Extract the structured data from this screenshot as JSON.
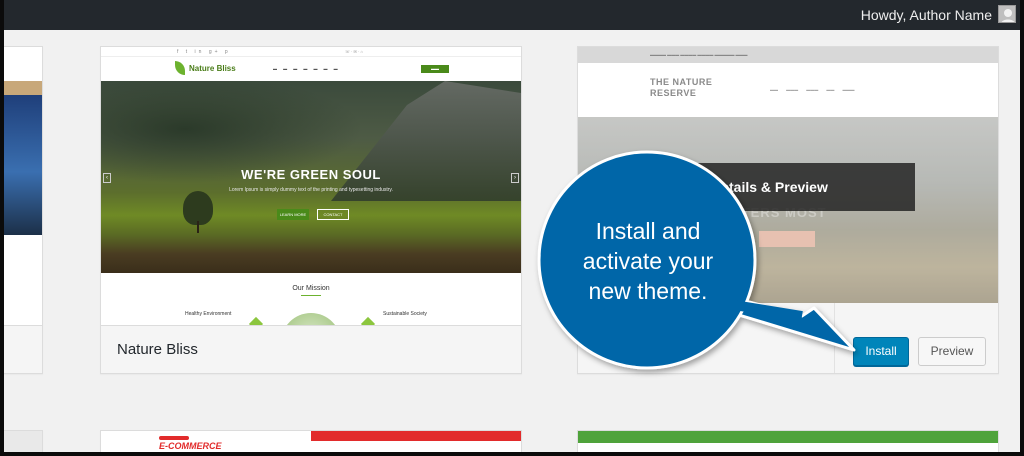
{
  "admin_bar": {
    "greeting": "Howdy, Author Name"
  },
  "themes": [
    {
      "name": "Nature Bliss",
      "screenshot": {
        "brand": "Nature Bliss",
        "headline": "WE'RE GREEN SOUL",
        "tagline": "Lorem Ipsum is simply dummy text of the printing and typesetting industry.",
        "primary_cta": "LEARN MORE",
        "secondary_cta": "CONTACT",
        "section_title": "Our Mission",
        "feature_1": "Healthy Environment",
        "feature_2": "Sustainable Society"
      }
    },
    {
      "name": "The Nature Reserve",
      "screenshot": {
        "logo_line1": "THE NATURE",
        "logo_line2": "RESERVE",
        "ghost_text": "T MATTERS MOST"
      },
      "overlay_label": "Details & Preview",
      "install_label": "Install",
      "preview_label": "Preview"
    },
    {
      "name": "E-Commerce",
      "screenshot": {
        "logo": "E-COMMERCE"
      }
    }
  ],
  "callout": {
    "lines": [
      "Install and",
      "activate your",
      "new theme."
    ],
    "color": "#0066a8"
  },
  "colors": {
    "admin_bar": "#23282d",
    "install_button": "#0085ba",
    "accent_green": "#4a8a1a"
  }
}
